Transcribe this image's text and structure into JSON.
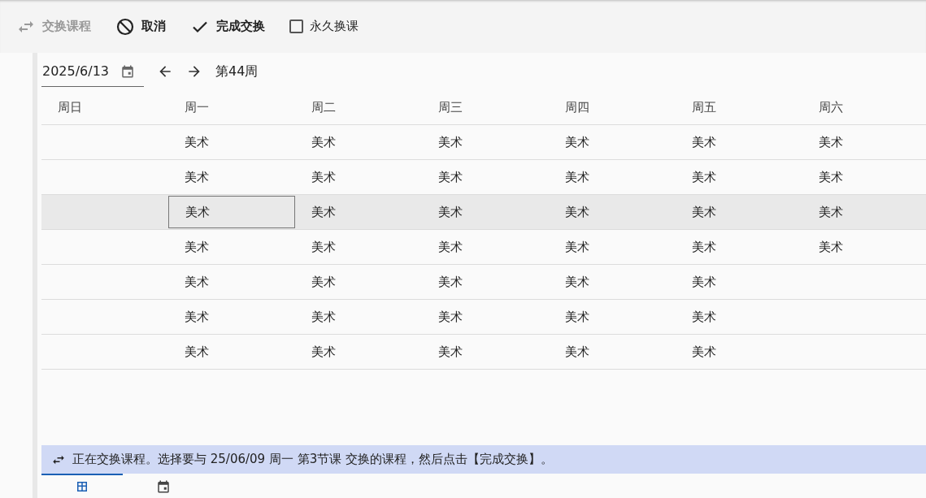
{
  "toolbar": {
    "items": [
      {
        "kind": "button",
        "label": "交换课程",
        "disabled": true
      },
      {
        "kind": "button",
        "label": "取消",
        "disabled": false
      },
      {
        "kind": "button",
        "label": "完成交换",
        "disabled": false
      },
      {
        "kind": "checkbox",
        "label": "永久换课",
        "checked": false
      }
    ]
  },
  "date_bar": {
    "date": "2025/6/13",
    "week": "第44周"
  },
  "table": {
    "columns": [
      "周日",
      "周一",
      "周二",
      "周三",
      "周四",
      "周五",
      "周六"
    ],
    "rows": [
      {
        "selected": false,
        "cells": [
          {
            "selected": false
          },
          {
            "text": "美术",
            "selected": false
          },
          {
            "text": "美术",
            "selected": false
          },
          {
            "text": "美术",
            "selected": false
          },
          {
            "text": "美术",
            "selected": false
          },
          {
            "text": "美术",
            "selected": false
          },
          {
            "text": "美术",
            "selected": false
          }
        ]
      },
      {
        "selected": false,
        "cells": [
          {
            "selected": false
          },
          {
            "text": "美术",
            "selected": false
          },
          {
            "text": "美术",
            "selected": false
          },
          {
            "text": "美术",
            "selected": false
          },
          {
            "text": "美术",
            "selected": false
          },
          {
            "text": "美术",
            "selected": false
          },
          {
            "text": "美术",
            "selected": false
          }
        ]
      },
      {
        "selected": true,
        "cells": [
          {
            "selected": false
          },
          {
            "text": "美术",
            "selected": true
          },
          {
            "text": "美术",
            "selected": false
          },
          {
            "text": "美术",
            "selected": false
          },
          {
            "text": "美术",
            "selected": false
          },
          {
            "text": "美术",
            "selected": false
          },
          {
            "text": "美术",
            "selected": false
          }
        ]
      },
      {
        "selected": false,
        "cells": [
          {
            "selected": false
          },
          {
            "text": "美术",
            "selected": false
          },
          {
            "text": "美术",
            "selected": false
          },
          {
            "text": "美术",
            "selected": false
          },
          {
            "text": "美术",
            "selected": false
          },
          {
            "text": "美术",
            "selected": false
          },
          {
            "text": "美术",
            "selected": false
          }
        ]
      },
      {
        "selected": false,
        "cells": [
          {
            "selected": false
          },
          {
            "text": "美术",
            "selected": false
          },
          {
            "text": "美术",
            "selected": false
          },
          {
            "text": "美术",
            "selected": false
          },
          {
            "text": "美术",
            "selected": false
          },
          {
            "text": "美术",
            "selected": false
          },
          {
            "selected": false
          }
        ]
      },
      {
        "selected": false,
        "cells": [
          {
            "selected": false
          },
          {
            "text": "美术",
            "selected": false
          },
          {
            "text": "美术",
            "selected": false
          },
          {
            "text": "美术",
            "selected": false
          },
          {
            "text": "美术",
            "selected": false
          },
          {
            "text": "美术",
            "selected": false
          },
          {
            "selected": false
          }
        ]
      },
      {
        "selected": false,
        "cells": [
          {
            "selected": false
          },
          {
            "text": "美术",
            "selected": false
          },
          {
            "text": "美术",
            "selected": false
          },
          {
            "text": "美术",
            "selected": false
          },
          {
            "text": "美术",
            "selected": false
          },
          {
            "text": "美术",
            "selected": false
          },
          {
            "selected": false
          }
        ]
      }
    ]
  },
  "info_bar": {
    "message": "正在交换课程。选择要与 25/06/09 周一 第3节课 交换的课程，然后点击【完成交换】。"
  },
  "view_tabs": [
    {
      "selected": true
    },
    {
      "selected": false
    }
  ]
}
